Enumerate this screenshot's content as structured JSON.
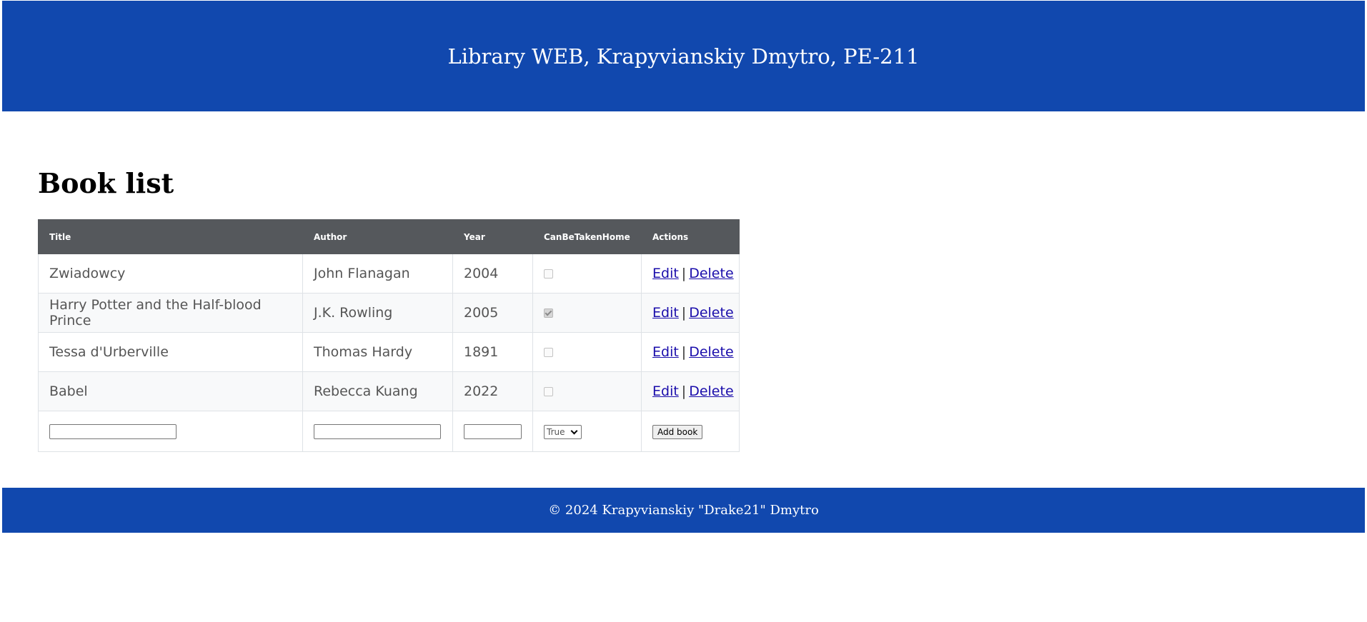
{
  "header": {
    "title": "Library WEB, Krapyvianskiy Dmytro, PE-211"
  },
  "page": {
    "heading": "Book list"
  },
  "table": {
    "columns": [
      "Title",
      "Author",
      "Year",
      "CanBeTakenHome",
      "Actions"
    ],
    "rows": [
      {
        "title": "Zwiadowcy",
        "author": "John Flanagan",
        "year": "2004",
        "can_be_taken_home": false
      },
      {
        "title": "Harry Potter and the Half-blood Prince",
        "author": "J.K. Rowling",
        "year": "2005",
        "can_be_taken_home": true
      },
      {
        "title": "Tessa d'Urberville",
        "author": "Thomas Hardy",
        "year": "1891",
        "can_be_taken_home": false
      },
      {
        "title": "Babel",
        "author": "Rebecca Kuang",
        "year": "2022",
        "can_be_taken_home": false
      }
    ],
    "edit_label": "Edit",
    "separator": "|",
    "delete_label": "Delete"
  },
  "form": {
    "title_value": "",
    "author_value": "",
    "year_value": "",
    "can_take_home_selected": "True",
    "add_button_label": "Add book"
  },
  "footer": {
    "text": "© 2024 Krapyvianskiy \"Drake21\" Dmytro"
  },
  "colors": {
    "header_bg": "#1148ae",
    "table_header_bg": "#55585c",
    "link": "#1a0dab"
  }
}
